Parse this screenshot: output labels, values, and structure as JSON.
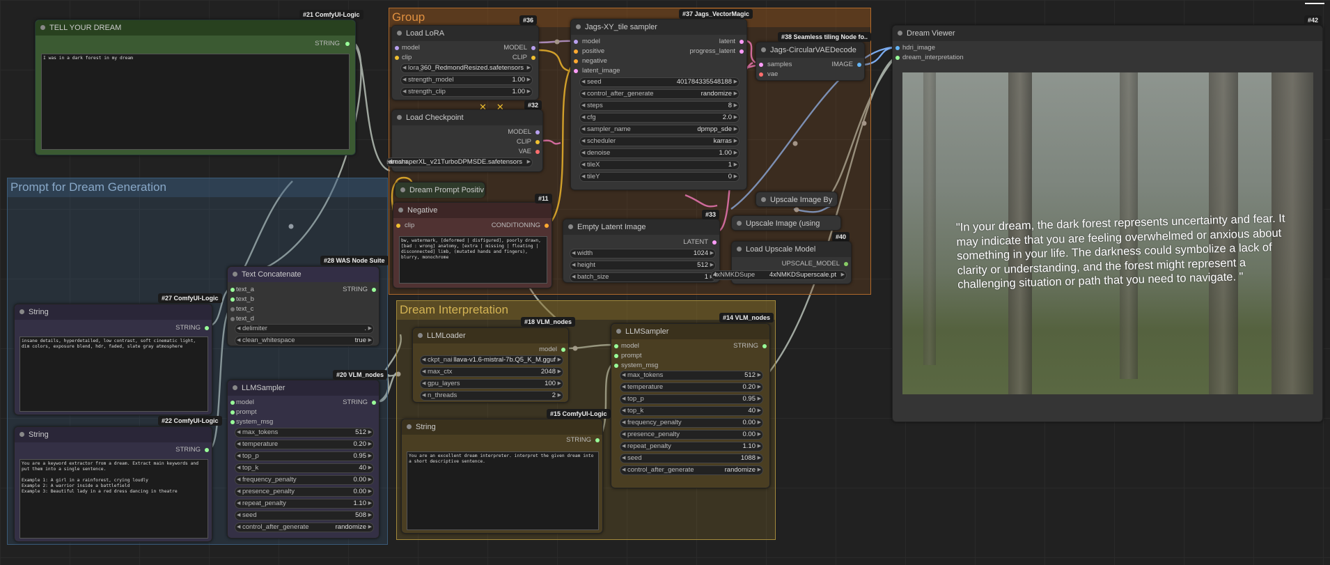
{
  "groups": {
    "group": "Group",
    "prompt": "Prompt for Dream Generation",
    "interp": "Dream Interpretation"
  },
  "ids": {
    "n21": "#21 ComfyUI-Logic",
    "n36": "#36",
    "n37": "#37 Jags_VectorMagic",
    "n38": "#38 Seamless tiling Node fo..",
    "n42": "#42",
    "n32": "#32",
    "n11": "#11",
    "n33": "#33",
    "n40": "#40",
    "n28": "#28 WAS Node Suite",
    "n27": "#27 ComfyUI-Logic",
    "n22": "#22 ComfyUI-Logic",
    "n20": "#20 VLM_nodes",
    "n18": "#18 VLM_nodes",
    "n14": "#14 VLM_nodes",
    "n15": "#15 ComfyUI-Logic"
  },
  "tell": {
    "title": "TELL YOUR DREAM",
    "out": "STRING",
    "text": "I was in a dark forest in my dream"
  },
  "lora": {
    "title": "Load LoRA",
    "in_model": "model",
    "in_clip": "clip",
    "out_model": "MODEL",
    "out_clip": "CLIP",
    "w": [
      [
        "lora_",
        "360_RedmondResized.safetensors"
      ],
      [
        "strength_model",
        "1.00"
      ],
      [
        "strength_clip",
        "1.00"
      ]
    ]
  },
  "ckpt": {
    "title": "Load Checkpoint",
    "out_model": "MODEL",
    "out_clip": "CLIP",
    "out_vae": "VAE",
    "w_label": "dream",
    "w_val": "dreamshaperXL_v21TurboDPMSDE.safetensors"
  },
  "xy": {
    "title": "Jags-XY_tile sampler",
    "ins": [
      "model",
      "positive",
      "negative",
      "latent_image"
    ],
    "outs": [
      "latent",
      "progress_latent"
    ],
    "w": [
      [
        "seed",
        "401784335548188"
      ],
      [
        "control_after_generate",
        "randomize"
      ],
      [
        "steps",
        "8"
      ],
      [
        "cfg",
        "2.0"
      ],
      [
        "sampler_name",
        "dpmpp_sde"
      ],
      [
        "scheduler",
        "karras"
      ],
      [
        "denoise",
        "1.00"
      ],
      [
        "tileX",
        "1"
      ],
      [
        "tileY",
        "0"
      ]
    ]
  },
  "vaedec": {
    "title": "Jags-CircularVAEDecode",
    "in_samples": "samples",
    "in_vae": "vae",
    "out": "IMAGE"
  },
  "dpp": {
    "title": "Dream Prompt Positiv"
  },
  "neg": {
    "title": "Negative",
    "in": "clip",
    "out": "CONDITIONING",
    "text": "bw, watermark, [deformed | disfigured], poorly drawn, [bad : wrong] anatomy, [extra | missing | floating | disconnected] limb, (mutated hands and fingers), blurry, monochrome"
  },
  "empty": {
    "title": "Empty Latent Image",
    "out": "LATENT",
    "w": [
      [
        "width",
        "1024"
      ],
      [
        "height",
        "512"
      ],
      [
        "batch_size",
        "1"
      ]
    ]
  },
  "upby": {
    "title": "Upscale Image By"
  },
  "upusing": {
    "title": "Upscale Image (using"
  },
  "upload": {
    "title": "Load Upscale Model",
    "out": "UPSCALE_MODEL",
    "w_label": "4xNMKDSupe",
    "w_val": "4xNMKDSuperscale.pt"
  },
  "viewer": {
    "title": "Dream Viewer",
    "ins": [
      "hdri_image",
      "dream_interpretation"
    ],
    "text": "\"In your dream, the dark forest represents uncertainty and fear. It may indicate that you are feeling overwhelmed or anxious about something in your life. The darkness could symbolize a lack of clarity or understanding, and the forest might represent a challenging situation or path that you need to navigate.\n\""
  },
  "concat": {
    "title": "Text Concatenate",
    "ins": [
      "text_a",
      "text_b",
      "text_c",
      "text_d"
    ],
    "out": "STRING",
    "w": [
      [
        "delimiter",
        "."
      ],
      [
        "clean_whitespace",
        "true"
      ]
    ]
  },
  "str27": {
    "title": "String",
    "out": "STRING",
    "text": "insane details, hyperdetailed, low contrast, soft cinematic light, dim colors, exposure blend, hdr, faded, slate gray atmosphere"
  },
  "str22": {
    "title": "String",
    "out": "STRING",
    "text": "You are a keyword extractor from a dream. Extract main keywords and put them into a single sentence.\n\nExample 1: A girl in a rainforest, crying loudly\nExample 2: A warrior inside a battlefield\nExample 3: Beautiful lady in a red dress dancing in theatre"
  },
  "llm20": {
    "title": "LLMSampler",
    "ins": [
      "model",
      "prompt",
      "system_msg"
    ],
    "out": "STRING",
    "w": [
      [
        "max_tokens",
        "512"
      ],
      [
        "temperature",
        "0.20"
      ],
      [
        "top_p",
        "0.95"
      ],
      [
        "top_k",
        "40"
      ],
      [
        "frequency_penalty",
        "0.00"
      ],
      [
        "presence_penalty",
        "0.00"
      ],
      [
        "repeat_penalty",
        "1.10"
      ],
      [
        "seed",
        "508"
      ],
      [
        "control_after_generate",
        "randomize"
      ]
    ]
  },
  "loader": {
    "title": "LLMLoader",
    "out": "model",
    "w": [
      [
        "ckpt_nai",
        "llava-v1.6-mistral-7b.Q5_K_M.gguf"
      ],
      [
        "max_ctx",
        "2048"
      ],
      [
        "gpu_layers",
        "100"
      ],
      [
        "n_threads",
        "2"
      ]
    ]
  },
  "llm14": {
    "title": "LLMSampler",
    "ins": [
      "model",
      "prompt",
      "system_msg"
    ],
    "out": "STRING",
    "w": [
      [
        "max_tokens",
        "512"
      ],
      [
        "temperature",
        "0.20"
      ],
      [
        "top_p",
        "0.95"
      ],
      [
        "top_k",
        "40"
      ],
      [
        "frequency_penalty",
        "0.00"
      ],
      [
        "presence_penalty",
        "0.00"
      ],
      [
        "repeat_penalty",
        "1.10"
      ],
      [
        "seed",
        "1088"
      ],
      [
        "control_after_generate",
        "randomize"
      ]
    ]
  },
  "str15": {
    "title": "String",
    "out": "STRING",
    "text": "You are an excellent dream interpreter. interpret the given dream into a short descriptive sentence."
  },
  "colors": {
    "group_orange": "#b06a2c",
    "group_blue": "#3a5a78",
    "group_gold": "#a38a3c",
    "tell_green": "#3b5a32",
    "neg_red": "#503232",
    "wire_blue": "#7aaaee",
    "wire_pink": "#ee77cc",
    "wire_yellow": "#f0c030",
    "wire_gray": "#a0a8a0"
  }
}
